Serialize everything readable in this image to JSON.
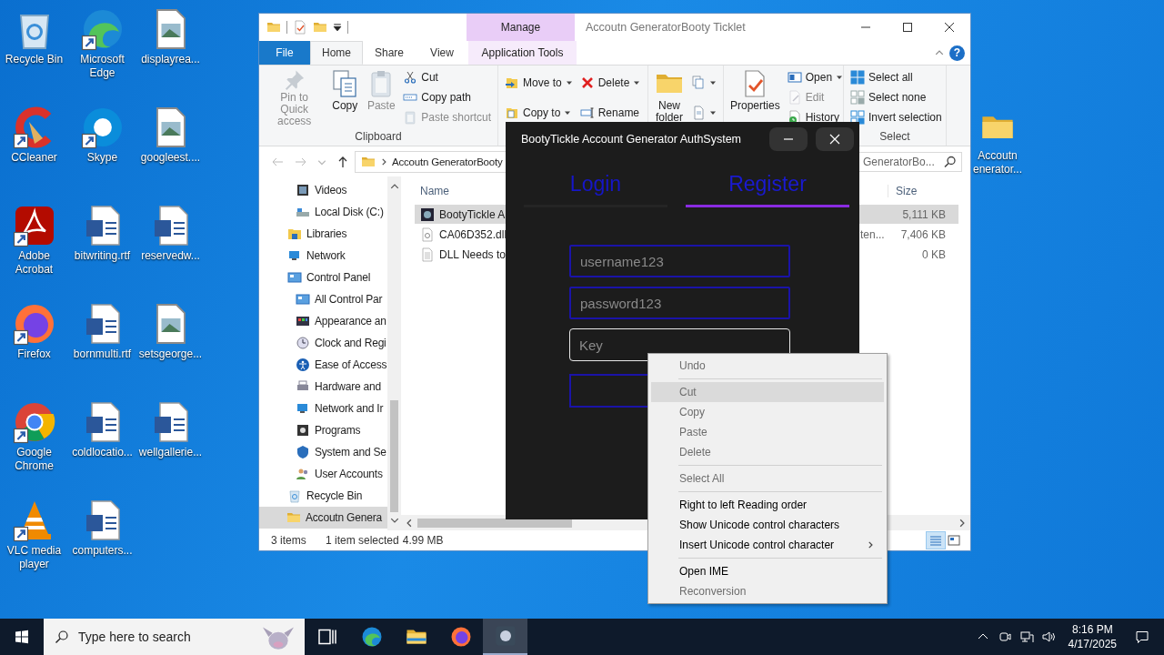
{
  "desktop": {
    "icons": [
      {
        "label": "Recycle Bin",
        "kind": "recycle"
      },
      {
        "label": "CCleaner",
        "kind": "cleaner"
      },
      {
        "label": "Adobe Acrobat",
        "kind": "acrobat"
      },
      {
        "label": "Firefox",
        "kind": "firefox"
      },
      {
        "label": "Google Chrome",
        "kind": "chrome"
      },
      {
        "label": "VLC media player",
        "kind": "vlc"
      },
      {
        "label": "Microsoft Edge",
        "kind": "edge"
      },
      {
        "label": "Skype",
        "kind": "skype"
      },
      {
        "label": "bitwriting.rtf",
        "kind": "word"
      },
      {
        "label": "bornmulti.rtf",
        "kind": "word"
      },
      {
        "label": "coldlocatio...",
        "kind": "word"
      },
      {
        "label": "computers...",
        "kind": "word"
      },
      {
        "label": "displayrea...",
        "kind": "image"
      },
      {
        "label": "googleest....",
        "kind": "image"
      },
      {
        "label": "reservedw...",
        "kind": "word"
      },
      {
        "label": "setsgeorge...",
        "kind": "image"
      },
      {
        "label": "wellgallerie...",
        "kind": "word"
      }
    ],
    "partial_icon": {
      "kind": "folder",
      "lines": [
        "Accoutn",
        "enerator..."
      ]
    }
  },
  "explorer": {
    "title": "Accoutn GeneratorBooty Ticklet",
    "context_tab": "Manage",
    "help": "?",
    "tabs": [
      {
        "label": "File",
        "kind": "file",
        "selected": false
      },
      {
        "label": "Home",
        "kind": "tab",
        "selected": true
      },
      {
        "label": "Share",
        "kind": "tab",
        "selected": false
      },
      {
        "label": "View",
        "kind": "tab",
        "selected": false
      },
      {
        "label": "Application Tools",
        "kind": "context",
        "selected": false
      }
    ],
    "ribbon": {
      "groups": [
        {
          "label": "Clipboard",
          "large": [
            {
              "label": "Pin to Quick access",
              "kind": "pin",
              "disabled": true
            },
            {
              "label": "Copy",
              "kind": "copy",
              "disabled": false
            },
            {
              "label": "Paste",
              "kind": "paste",
              "disabled": true
            }
          ],
          "small": [
            [
              {
                "label": "Cut",
                "kind": "cut",
                "disabled": false
              },
              {
                "label": "Copy path",
                "kind": "copypath",
                "disabled": false
              },
              {
                "label": "Paste shortcut",
                "kind": "pasteshortcut",
                "disabled": true
              }
            ]
          ]
        },
        {
          "small": [
            [
              {
                "label": "Move to",
                "kind": "moveto",
                "dropdown": true,
                "disabled": false
              },
              {
                "label": "Copy to",
                "kind": "copyto",
                "dropdown": true,
                "disabled": false
              }
            ],
            [
              {
                "label": "Delete",
                "kind": "delete",
                "dropdown": true,
                "disabled": false
              },
              {
                "label": "Rename",
                "kind": "rename",
                "disabled": false
              }
            ]
          ]
        },
        {
          "large": [
            {
              "label": "New folder",
              "kind": "newfolder",
              "disabled": false
            }
          ],
          "small": [
            [
              {
                "kind": "newitem",
                "dropdown": true,
                "disabled": false
              },
              {
                "kind": "easyaccess",
                "dropdown": true,
                "disabled": false
              }
            ]
          ]
        },
        {
          "large": [
            {
              "label": "Properties",
              "kind": "properties",
              "disabled": false
            }
          ],
          "small": [
            [
              {
                "label": "Open",
                "kind": "open",
                "dropdown": true,
                "disabled": false
              },
              {
                "label": "Edit",
                "kind": "edit",
                "disabled": true
              },
              {
                "label": "History",
                "kind": "history",
                "disabled": false
              }
            ]
          ]
        },
        {
          "label": "Select",
          "small": [
            [
              {
                "label": "Select all",
                "kind": "selectall",
                "disabled": false
              },
              {
                "label": "Select none",
                "kind": "selectnone",
                "disabled": false
              },
              {
                "label": "Invert selection",
                "kind": "invert",
                "disabled": false
              }
            ]
          ]
        }
      ]
    },
    "address": {
      "path": "Accoutn GeneratorBooty",
      "search_placeholder": "GeneratorBo..."
    },
    "nav": {
      "partial_children": [
        {
          "label": "Videos",
          "kind": "videos",
          "selected": false
        },
        {
          "label": "Local Disk (C:)",
          "kind": "disk",
          "selected": false
        }
      ],
      "items": [
        {
          "label": "Libraries",
          "kind": "libraries",
          "selected": false
        },
        {
          "label": "Network",
          "kind": "network",
          "selected": false
        },
        {
          "label": "Control Panel",
          "kind": "control",
          "selected": false,
          "children": [
            {
              "label": "All Control Par",
              "kind": "control",
              "selected": false
            },
            {
              "label": "Appearance an",
              "kind": "appearance",
              "selected": false
            },
            {
              "label": "Clock and Regi",
              "kind": "clock",
              "selected": false
            },
            {
              "label": "Ease of Access",
              "kind": "ease",
              "selected": false
            },
            {
              "label": "Hardware and",
              "kind": "hardware",
              "selected": false
            },
            {
              "label": "Network and Ir",
              "kind": "network",
              "selected": false
            },
            {
              "label": "Programs",
              "kind": "programs",
              "selected": false
            },
            {
              "label": "System and Se",
              "kind": "system",
              "selected": false
            },
            {
              "label": "User Accounts",
              "kind": "users",
              "selected": false
            }
          ]
        },
        {
          "label": "Recycle Bin",
          "kind": "recycle",
          "selected": false
        },
        {
          "label": "Accoutn Genera",
          "kind": "folder",
          "selected": true
        }
      ]
    },
    "files": {
      "columns": [
        "Name",
        "Size"
      ],
      "rows": [
        {
          "name": "BootyTickle A",
          "kind": "app",
          "size": "5,111 KB",
          "selected": true
        },
        {
          "name": "CA06D352.dll",
          "kind": "dll",
          "type": "ten...",
          "size": "7,406 KB",
          "selected": false
        },
        {
          "name": "DLL Needs to",
          "kind": "text",
          "size": "0 KB",
          "selected": false
        }
      ]
    },
    "status": {
      "count": "3 items",
      "selection": "1 item selected",
      "size": "4.99 MB"
    }
  },
  "auth_window": {
    "title": "BootyTickle Account Generator AuthSystem",
    "tabs": [
      {
        "label": "Login",
        "selected": false
      },
      {
        "label": "Register",
        "selected": true
      }
    ],
    "fields": [
      {
        "placeholder": "username123",
        "focused": false
      },
      {
        "placeholder": "password123",
        "focused": false
      },
      {
        "placeholder": "Key",
        "focused": true
      }
    ]
  },
  "context_menu": {
    "items": [
      {
        "kind": "item",
        "label": "Undo",
        "disabled": true,
        "selected": false
      },
      {
        "kind": "separator"
      },
      {
        "kind": "item",
        "label": "Cut",
        "disabled": true,
        "selected": true
      },
      {
        "kind": "item",
        "label": "Copy",
        "disabled": true,
        "selected": false
      },
      {
        "kind": "item",
        "label": "Paste",
        "disabled": true,
        "selected": false
      },
      {
        "kind": "item",
        "label": "Delete",
        "disabled": true,
        "selected": false
      },
      {
        "kind": "separator"
      },
      {
        "kind": "item",
        "label": "Select All",
        "disabled": true,
        "selected": false
      },
      {
        "kind": "separator"
      },
      {
        "kind": "item",
        "label": "Right to left Reading order",
        "disabled": false,
        "selected": false
      },
      {
        "kind": "item",
        "label": "Show Unicode control characters",
        "disabled": false,
        "selected": false
      },
      {
        "kind": "item",
        "label": "Insert Unicode control character",
        "disabled": false,
        "selected": false,
        "submenu": true
      },
      {
        "kind": "separator"
      },
      {
        "kind": "item",
        "label": "Open IME",
        "disabled": false,
        "selected": false
      },
      {
        "kind": "item",
        "label": "Reconversion",
        "disabled": true,
        "selected": false
      }
    ]
  },
  "taskbar": {
    "search_placeholder": "Type here to search",
    "apps": [
      {
        "kind": "taskview",
        "active": false
      },
      {
        "kind": "edge",
        "active": false
      },
      {
        "kind": "explorer",
        "active": false
      },
      {
        "kind": "firefox",
        "active": false
      },
      {
        "kind": "authapp",
        "active": true
      }
    ],
    "clock": {
      "time": "8:16 PM",
      "date": "4/17/2025"
    }
  }
}
